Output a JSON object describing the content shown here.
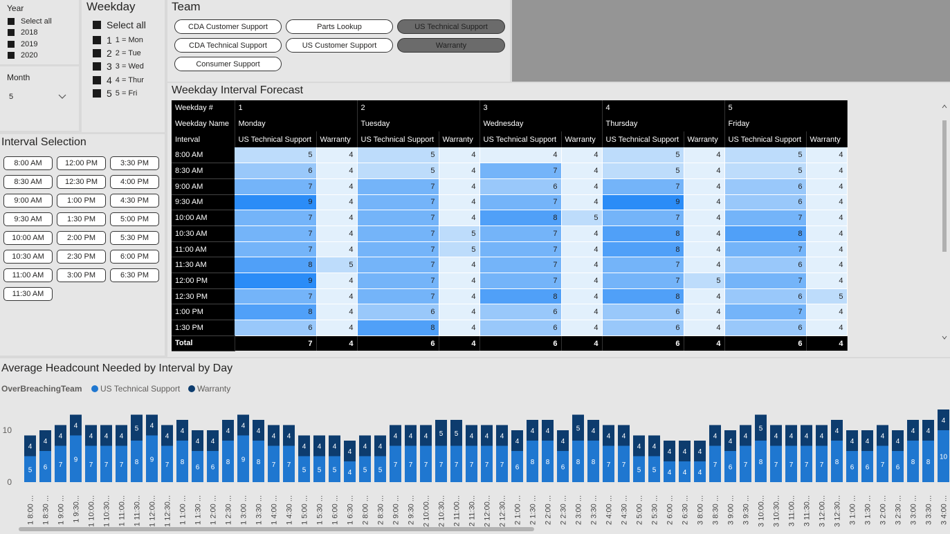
{
  "year_slicer": {
    "title": "Year",
    "items": [
      "Select all",
      "2018",
      "2019",
      "2020"
    ]
  },
  "month_slicer": {
    "title": "Month",
    "value": "5"
  },
  "weekday_slicer": {
    "title": "Weekday",
    "select_all": "Select all",
    "items": [
      {
        "num": "1",
        "label": "1 = Mon"
      },
      {
        "num": "2",
        "label": "2 = Tue"
      },
      {
        "num": "3",
        "label": "3 = Wed"
      },
      {
        "num": "4",
        "label": "4 = Thur"
      },
      {
        "num": "5",
        "label": "5 = Fri"
      }
    ]
  },
  "team_slicer": {
    "title": "Team",
    "items": [
      "CDA Customer Support",
      "Parts Lookup",
      "US Technical Support",
      "CDA Technical Support",
      "US Customer Support",
      "Warranty",
      "Consumer Support"
    ],
    "selected": [
      "US Technical Support",
      "Warranty"
    ]
  },
  "interval_slicer": {
    "title": "Interval Selection",
    "items": [
      "8:00 AM",
      "12:00 PM",
      "3:30 PM",
      "8:30 AM",
      "12:30 PM",
      "4:00 PM",
      "9:00 AM",
      "1:00 PM",
      "4:30 PM",
      "9:30 AM",
      "1:30 PM",
      "5:00 PM",
      "10:00 AM",
      "2:00 PM",
      "5:30 PM",
      "10:30 AM",
      "2:30 PM",
      "6:00 PM",
      "11:00 AM",
      "3:00 PM",
      "6:30 PM",
      "11:30 AM"
    ]
  },
  "forecast_table": {
    "title": "Weekday Interval Forecast",
    "row_headers": [
      "Weekday #",
      "Weekday Name",
      "Interval"
    ],
    "weekday_nums": [
      "1",
      "2",
      "3",
      "4",
      "5"
    ],
    "weekday_names": [
      "Monday",
      "Tuesday",
      "Wednesday",
      "Thursday",
      "Friday"
    ],
    "team_cols": [
      "US Technical Support",
      "Warranty"
    ],
    "rows": [
      {
        "interval": "8:00 AM",
        "values": [
          5,
          4,
          5,
          4,
          4,
          4,
          5,
          4,
          5,
          4
        ]
      },
      {
        "interval": "8:30 AM",
        "values": [
          6,
          4,
          5,
          4,
          7,
          4,
          5,
          4,
          5,
          4
        ]
      },
      {
        "interval": "9:00 AM",
        "values": [
          7,
          4,
          7,
          4,
          6,
          4,
          7,
          4,
          6,
          4
        ]
      },
      {
        "interval": "9:30 AM",
        "values": [
          9,
          4,
          7,
          4,
          7,
          4,
          9,
          4,
          6,
          4
        ]
      },
      {
        "interval": "10:00 AM",
        "values": [
          7,
          4,
          7,
          4,
          8,
          5,
          7,
          4,
          7,
          4
        ]
      },
      {
        "interval": "10:30 AM",
        "values": [
          7,
          4,
          7,
          5,
          7,
          4,
          8,
          4,
          8,
          4
        ]
      },
      {
        "interval": "11:00 AM",
        "values": [
          7,
          4,
          7,
          5,
          7,
          4,
          8,
          4,
          7,
          4
        ]
      },
      {
        "interval": "11:30 AM",
        "values": [
          8,
          5,
          7,
          4,
          7,
          4,
          7,
          4,
          6,
          4
        ]
      },
      {
        "interval": "12:00 PM",
        "values": [
          9,
          4,
          7,
          4,
          7,
          4,
          7,
          5,
          7,
          4
        ]
      },
      {
        "interval": "12:30 PM",
        "values": [
          7,
          4,
          7,
          4,
          8,
          4,
          8,
          4,
          6,
          5
        ]
      },
      {
        "interval": "1:00 PM",
        "values": [
          8,
          4,
          6,
          4,
          6,
          4,
          6,
          4,
          7,
          4
        ]
      },
      {
        "interval": "1:30 PM",
        "values": [
          6,
          4,
          8,
          4,
          6,
          4,
          6,
          4,
          6,
          4
        ]
      }
    ],
    "total_label": "Total",
    "totals": [
      7,
      4,
      6,
      4,
      6,
      4,
      6,
      4,
      6,
      4
    ]
  },
  "chart_data": {
    "type": "bar",
    "title": "Average Headcount Needed by Interval by Day",
    "legend_title": "OverBreachingTeam",
    "legend_position": "top-left",
    "stacked": true,
    "ylim": [
      0,
      14
    ],
    "yticks": [
      0,
      10
    ],
    "categories": [
      "1 8:00 ...",
      "1 8:30 ...",
      "1 9:00 ...",
      "1 9:30...",
      "1 10:00...",
      "1 10:30...",
      "1 11:00...",
      "1 11:30...",
      "1 12:00...",
      "1 12:30...",
      "1 1:00 ...",
      "1 1:30 ...",
      "1 2:00 ...",
      "1 2:30 ...",
      "1 3:00 ...",
      "1 3:30 ...",
      "1 4:00 ...",
      "1 4:30 ...",
      "1 5:00 ...",
      "1 5:30 ...",
      "1 6:00 ...",
      "1 6:30 ...",
      "2 8:00 ...",
      "2 8:30 ...",
      "2 9:00 ...",
      "2 9:30 ...",
      "2 10:00...",
      "2 10:30...",
      "2 11:00...",
      "2 11:30...",
      "2 12:00...",
      "2 12:30...",
      "2 1:00 ...",
      "2 1:30 ...",
      "2 2:00 ...",
      "2 2:30 ...",
      "2 3:00 ...",
      "2 3:30 ...",
      "2 4:00 ...",
      "2 4:30 ...",
      "2 5:00 ...",
      "2 5:30 ...",
      "2 6:00 ...",
      "2 6:30 ...",
      "3 8:00 ...",
      "3 8:30 ...",
      "3 9:00 ...",
      "3 9:30 ...",
      "3 10:00...",
      "3 10:30...",
      "3 11:00...",
      "3 11:30...",
      "3 12:00...",
      "3 12:30...",
      "3 1:00 ...",
      "3 1:30 ...",
      "3 2:00 ...",
      "3 2:30 ...",
      "3 3:00 ...",
      "3 3:30 ...",
      "3 4:00 ..."
    ],
    "series": [
      {
        "name": "US Technical Support",
        "color": "#1f77d0",
        "values": [
          5,
          6,
          7,
          9,
          7,
          7,
          7,
          8,
          9,
          7,
          8,
          6,
          6,
          8,
          9,
          8,
          7,
          7,
          5,
          5,
          5,
          4,
          5,
          5,
          7,
          7,
          7,
          7,
          7,
          7,
          7,
          7,
          6,
          8,
          8,
          6,
          8,
          8,
          7,
          7,
          5,
          5,
          4,
          4,
          4,
          7,
          6,
          7,
          8,
          7,
          7,
          7,
          7,
          8,
          6,
          6,
          7,
          6,
          8,
          8,
          10
        ]
      },
      {
        "name": "Warranty",
        "color": "#0d3c6e",
        "values": [
          4,
          4,
          4,
          4,
          4,
          4,
          4,
          5,
          4,
          4,
          4,
          4,
          4,
          4,
          4,
          4,
          4,
          4,
          4,
          4,
          4,
          4,
          4,
          4,
          4,
          4,
          4,
          5,
          5,
          4,
          4,
          4,
          4,
          4,
          4,
          4,
          5,
          4,
          4,
          4,
          4,
          4,
          4,
          4,
          4,
          4,
          4,
          4,
          5,
          4,
          4,
          4,
          4,
          4,
          4,
          4,
          4,
          4,
          4,
          4,
          4
        ]
      }
    ]
  }
}
